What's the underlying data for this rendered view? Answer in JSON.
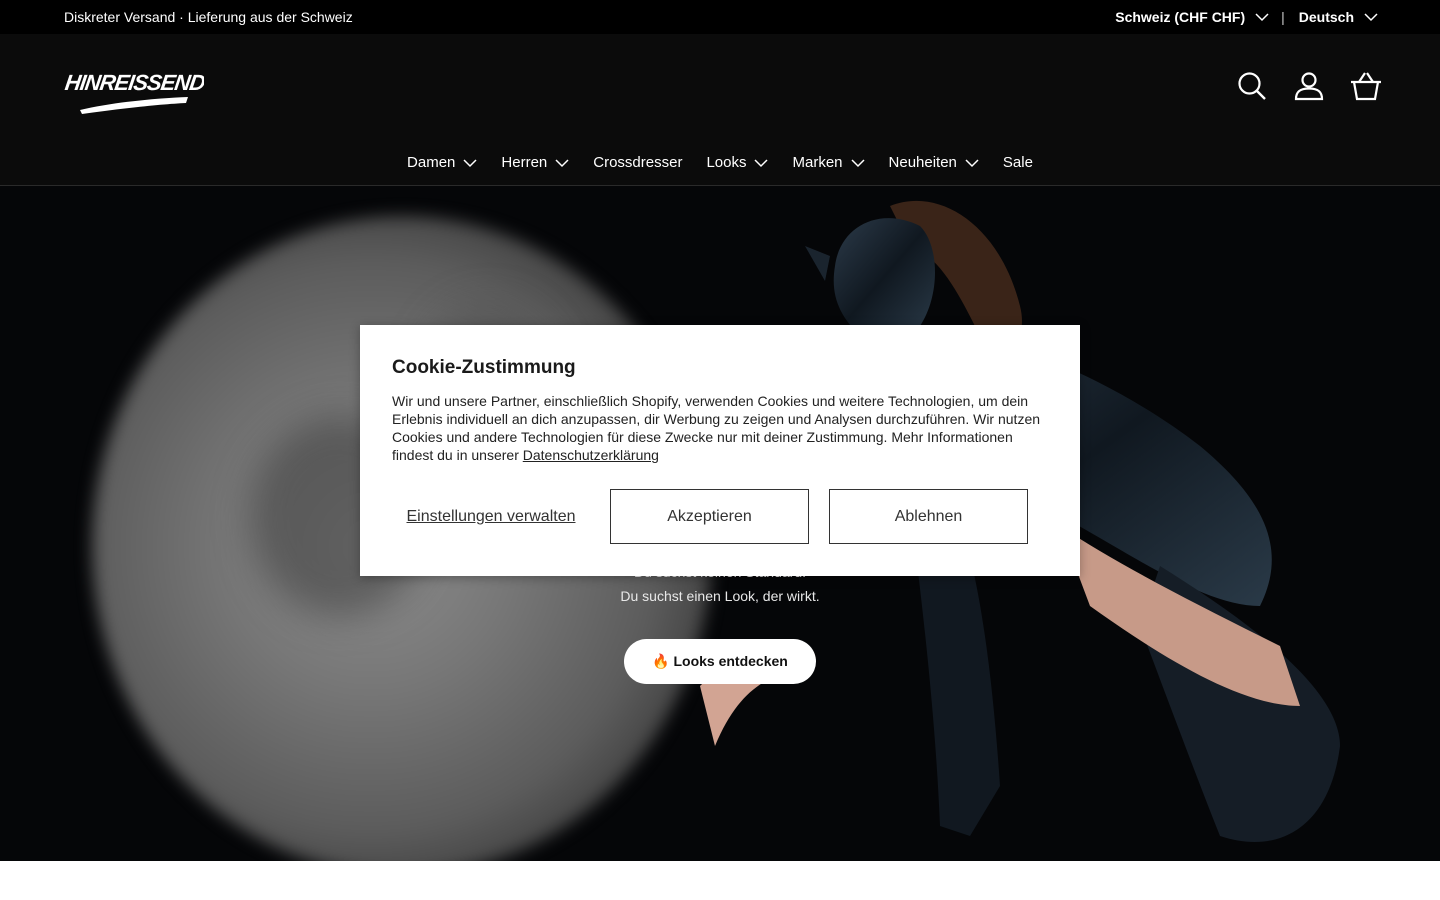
{
  "announcement": "Diskreter Versand · Lieferung aus der Schweiz",
  "locale": {
    "country": "Schweiz (CHF CHF)",
    "separator": "|",
    "language": "Deutsch"
  },
  "logo_text": "HINREISSEND",
  "nav": [
    {
      "label": "Damen",
      "has_dropdown": true
    },
    {
      "label": "Herren",
      "has_dropdown": true
    },
    {
      "label": "Crossdresser",
      "has_dropdown": false
    },
    {
      "label": "Looks",
      "has_dropdown": true
    },
    {
      "label": "Marken",
      "has_dropdown": true
    },
    {
      "label": "Neuheiten",
      "has_dropdown": true
    },
    {
      "label": "Sale",
      "has_dropdown": false
    }
  ],
  "header_icons": [
    "search-icon",
    "account-icon",
    "basket-icon"
  ],
  "hero": {
    "line1": "Du suchst keinen Standard.",
    "line2": "Du suchst einen Look, der wirkt.",
    "cta": "🔥 Looks entdecken"
  },
  "cookie": {
    "title": "Cookie-Zustimmung",
    "body": "Wir und unsere Partner, einschließlich Shopify, verwenden Cookies und weitere Technologien, um dein Erlebnis individuell an dich anzupassen, dir Werbung zu zeigen und Analysen durchzuführen. Wir nutzen Cookies und andere Technologien für diese Zwecke nur mit deiner Zustimmung. Mehr Informationen findest du in unserer",
    "link": "Datenschutzerklärung",
    "manage": "Einstellungen verwalten",
    "accept": "Akzeptieren",
    "decline": "Ablehnen"
  },
  "colors": {
    "topbar_bg": "#000000",
    "header_bg": "#0b0b0b",
    "modal_bg": "#ffffff",
    "cta_bg": "#ffffff"
  }
}
